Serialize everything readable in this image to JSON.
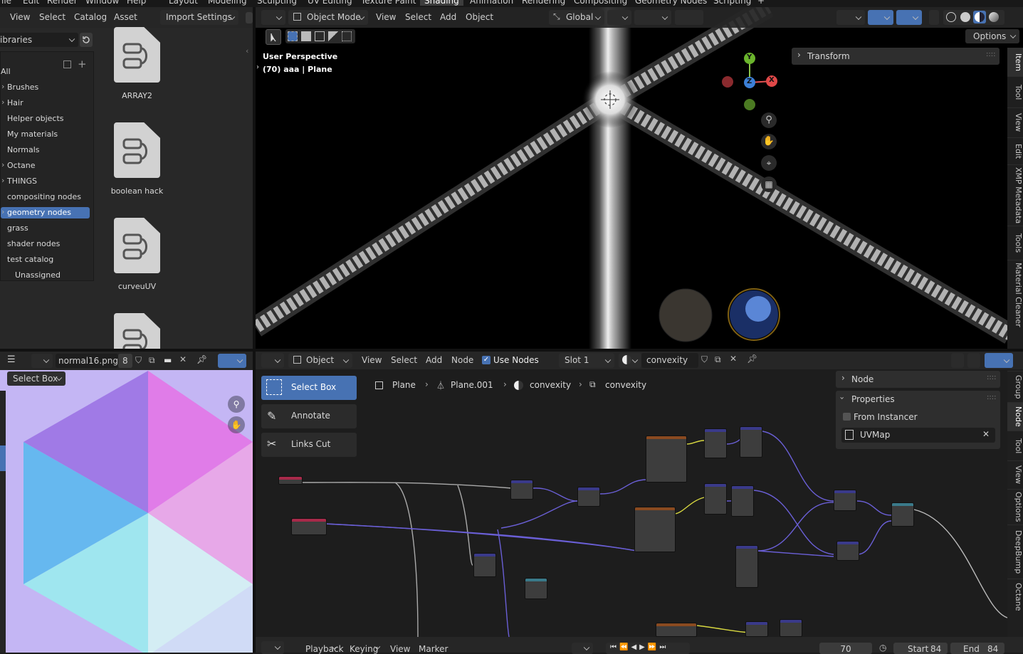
{
  "top_bar": {
    "menus": [
      "ile",
      "Edit",
      "Render",
      "Window",
      "Help"
    ],
    "workspace_tabs": [
      "Layout",
      "Modeling",
      "Sculpting",
      "UV Editing",
      "Texture Paint",
      "Shading",
      "Animation",
      "Rendering",
      "Compositing",
      "Geometry Nodes",
      "Scripting"
    ],
    "active_tab": "Shading",
    "add_tab": "+"
  },
  "asset_browser": {
    "menus": [
      "View",
      "Select",
      "Catalog",
      "Asset"
    ],
    "import_settings": "Import Settings",
    "library_select": "ibraries",
    "tree": [
      {
        "label": "All",
        "active": false,
        "chevron": false
      },
      {
        "label": "Brushes",
        "active": false,
        "chevron": true
      },
      {
        "label": "Hair",
        "active": false,
        "chevron": true
      },
      {
        "label": "Helper objects",
        "active": false,
        "chevron": false
      },
      {
        "label": "My materials",
        "active": false,
        "chevron": false
      },
      {
        "label": "Normals",
        "active": false,
        "chevron": false
      },
      {
        "label": "Octane",
        "active": false,
        "chevron": true
      },
      {
        "label": "THINGS",
        "active": false,
        "chevron": true
      },
      {
        "label": "compositing nodes",
        "active": false,
        "chevron": false
      },
      {
        "label": "geometry nodes",
        "active": true,
        "chevron": true
      },
      {
        "label": "grass",
        "active": false,
        "chevron": false
      },
      {
        "label": "shader nodes",
        "active": false,
        "chevron": false
      },
      {
        "label": "test catalog",
        "active": false,
        "chevron": false
      },
      {
        "label": "Unassigned",
        "active": false,
        "chevron": false
      }
    ],
    "assets": [
      "ARRAY2",
      "boolean hack",
      "curveuUV",
      ""
    ]
  },
  "viewport": {
    "mode": "Object Mode",
    "menus": [
      "View",
      "Select",
      "Add",
      "Object"
    ],
    "orientation": "Global",
    "info_line1": "User Perspective",
    "info_line2": "(70) aaa | Plane",
    "options": "Options",
    "transform_panel": "Transform",
    "gizmo": {
      "x": "X",
      "y": "Y",
      "z": "Z"
    },
    "side_tabs": [
      "Item",
      "Tool",
      "View",
      "Edit",
      "XMP Metadata",
      "Tools",
      "Material Cleaner"
    ]
  },
  "image_editor": {
    "image_name": "normal16.png",
    "users": "8",
    "tool": "Select Box"
  },
  "node_editor": {
    "object_type": "Object",
    "menus": [
      "View",
      "Select",
      "Add",
      "Node"
    ],
    "use_nodes": "Use Nodes",
    "slot": "Slot 1",
    "material": "convexity",
    "breadcrumb": [
      "Plane",
      "Plane.001",
      "convexity",
      "convexity"
    ],
    "tools": [
      "Select Box",
      "Annotate",
      "Links Cut"
    ],
    "panel_node": "Node",
    "panel_properties": "Properties",
    "from_instancer": "From Instancer",
    "uvmap": "UVMap",
    "side_tabs": [
      "Group",
      "Node",
      "Tool",
      "View",
      "Options",
      "DeepBump",
      "Octane"
    ]
  },
  "timeline": {
    "menus": [
      "Playback",
      "Keying",
      "View",
      "Marker"
    ],
    "current_frame": "70",
    "start_label": "Start",
    "start": "84",
    "end_label": "End",
    "end": "84"
  },
  "colors": {
    "accent": "#4772b3",
    "panel": "#303030",
    "header": "#262626",
    "wire": "#6a5fd6"
  }
}
